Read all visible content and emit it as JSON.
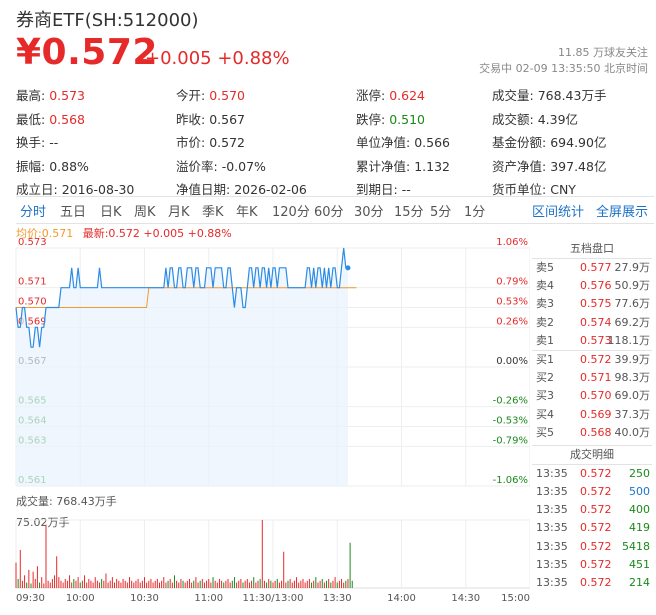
{
  "header": {
    "title": "券商ETF(SH:512000)",
    "price": "¥0.572",
    "change": "+0.005 +0.88%",
    "follow": "11.85 万球友关注",
    "status": "交易中 02-09 13:35:50 北京时间"
  },
  "stats": [
    [
      {
        "k": "最高:",
        "v": "0.573",
        "c": "red"
      },
      {
        "k": "今开:",
        "v": "0.570",
        "c": "red"
      },
      {
        "k": "涨停:",
        "v": "0.624",
        "c": "red"
      },
      {
        "k": "成交量:",
        "v": "768.43万手",
        "c": ""
      }
    ],
    [
      {
        "k": "最低:",
        "v": "0.568",
        "c": "red"
      },
      {
        "k": "昨收:",
        "v": "0.567",
        "c": ""
      },
      {
        "k": "跌停:",
        "v": "0.510",
        "c": "green"
      },
      {
        "k": "成交额:",
        "v": "4.39亿",
        "c": ""
      }
    ],
    [
      {
        "k": "换手:",
        "v": "--",
        "c": ""
      },
      {
        "k": "市价:",
        "v": "0.572",
        "c": ""
      },
      {
        "k": "单位净值:",
        "v": "0.566",
        "c": ""
      },
      {
        "k": "基金份额:",
        "v": "694.90亿",
        "c": ""
      }
    ],
    [
      {
        "k": "振幅:",
        "v": "0.88%",
        "c": ""
      },
      {
        "k": "溢价率:",
        "v": "-0.07%",
        "c": ""
      },
      {
        "k": "累计净值:",
        "v": "1.132",
        "c": ""
      },
      {
        "k": "资产净值:",
        "v": "397.48亿",
        "c": ""
      }
    ],
    [
      {
        "k": "成立日:",
        "v": "2016-08-30",
        "c": ""
      },
      {
        "k": "净值日期:",
        "v": "2026-02-06",
        "c": ""
      },
      {
        "k": "到期日:",
        "v": "--",
        "c": ""
      },
      {
        "k": "货币单位:",
        "v": "CNY",
        "c": ""
      }
    ]
  ],
  "tabs": [
    "分时",
    "五日",
    "日K",
    "周K",
    "月K",
    "季K",
    "年K",
    "120分",
    "60分",
    "30分",
    "15分",
    "5分",
    "1分"
  ],
  "tabs_right": [
    "区间统计",
    "全屏展示"
  ],
  "legend": {
    "avg": "均价:0.571",
    "last": "最新:0.572 +0.005 +0.88%"
  },
  "volume": {
    "label": "成交量: 768.43万手",
    "max": "75.02万手"
  },
  "order_book": {
    "title": "五档盘口",
    "asks": [
      {
        "label": "卖5",
        "price": "0.577",
        "qty": "27.9万"
      },
      {
        "label": "卖4",
        "price": "0.576",
        "qty": "50.9万"
      },
      {
        "label": "卖3",
        "price": "0.575",
        "qty": "77.6万"
      },
      {
        "label": "卖2",
        "price": "0.574",
        "qty": "69.2万"
      },
      {
        "label": "卖1",
        "price": "0.573",
        "qty": "118.1万"
      }
    ],
    "bids": [
      {
        "label": "买1",
        "price": "0.572",
        "qty": "39.9万"
      },
      {
        "label": "买2",
        "price": "0.571",
        "qty": "98.3万"
      },
      {
        "label": "买3",
        "price": "0.570",
        "qty": "69.0万"
      },
      {
        "label": "买4",
        "price": "0.569",
        "qty": "37.3万"
      },
      {
        "label": "买5",
        "price": "0.568",
        "qty": "40.0万"
      }
    ]
  },
  "trades": {
    "title": "成交明细",
    "rows": [
      {
        "time": "13:35",
        "price": "0.572",
        "qty": "250",
        "color": "#1a8a1a"
      },
      {
        "time": "13:35",
        "price": "0.572",
        "qty": "500",
        "color": "#1e73c8"
      },
      {
        "time": "13:35",
        "price": "0.572",
        "qty": "400",
        "color": "#1a8a1a"
      },
      {
        "time": "13:35",
        "price": "0.572",
        "qty": "419",
        "color": "#1a8a1a"
      },
      {
        "time": "13:35",
        "price": "0.572",
        "qty": "5418",
        "color": "#1a8a1a"
      },
      {
        "time": "13:35",
        "price": "0.572",
        "qty": "451",
        "color": "#1a8a1a"
      },
      {
        "time": "13:35",
        "price": "0.572",
        "qty": "214",
        "color": "#1a8a1a"
      }
    ]
  },
  "colors": {
    "up": "#e62a2a",
    "down": "#1a8a1a",
    "line": "#2b8be6",
    "avg": "#f29a2e",
    "accent": "#1e73c8"
  },
  "chart_data": {
    "type": "line",
    "title": "",
    "y_ticks": [
      "0.573",
      "0.571",
      "0.570",
      "0.569",
      "0.567",
      "0.565",
      "0.564",
      "0.563",
      "0.561"
    ],
    "y_tick_values": [
      0.573,
      0.571,
      0.57,
      0.569,
      0.567,
      0.565,
      0.564,
      0.563,
      0.561
    ],
    "pct_ticks": [
      "1.06%",
      "0.79%",
      "0.53%",
      "0.26%",
      "0.00%",
      "-0.26%",
      "-0.53%",
      "-0.79%",
      "-1.06%"
    ],
    "x_ticks": [
      "09:30",
      "10:00",
      "10:30",
      "11:00",
      "11:30/13:00",
      "13:30",
      "14:00",
      "14:30",
      "15:00"
    ],
    "ylim": [
      0.561,
      0.573
    ],
    "minutes_total": 240,
    "series": [
      {
        "values": [
          0.57,
          0.569,
          0.569,
          0.57,
          0.57,
          0.569,
          0.569,
          0.568,
          0.568,
          0.569,
          0.569,
          0.568,
          0.569,
          0.569,
          0.57,
          0.57,
          0.57,
          0.57,
          0.57,
          0.57,
          0.57,
          0.571,
          0.571,
          0.571,
          0.571,
          0.571,
          0.572,
          0.571,
          0.571,
          0.572,
          0.571,
          0.571,
          0.571,
          0.571,
          0.571,
          0.571,
          0.571,
          0.571,
          0.571,
          0.572,
          0.571,
          0.571,
          0.571,
          0.571,
          0.571,
          0.571,
          0.571,
          0.571,
          0.571,
          0.571,
          0.571,
          0.571,
          0.571,
          0.571,
          0.571,
          0.571,
          0.571,
          0.571,
          0.571,
          0.571,
          0.571,
          0.571,
          0.571,
          0.571,
          0.571,
          0.571,
          0.571,
          0.571,
          0.571,
          0.571,
          0.572,
          0.571,
          0.572,
          0.572,
          0.571,
          0.571,
          0.572,
          0.572,
          0.571,
          0.571,
          0.572,
          0.572,
          0.572,
          0.571,
          0.572,
          0.572,
          0.571,
          0.571,
          0.571,
          0.572,
          0.572,
          0.572,
          0.571,
          0.572,
          0.572,
          0.572,
          0.572,
          0.571,
          0.571,
          0.572,
          0.572,
          0.571,
          0.57,
          0.571,
          0.571,
          0.571,
          0.57,
          0.57,
          0.571,
          0.572,
          0.572,
          0.571,
          0.572,
          0.572,
          0.571,
          0.572,
          0.572,
          0.571,
          0.572,
          0.571,
          0.572,
          0.572,
          0.571,
          0.572,
          0.572,
          0.572,
          0.572,
          0.571,
          0.571,
          0.571,
          0.571,
          0.571,
          0.571,
          0.571,
          0.571,
          0.571,
          0.572,
          0.572,
          0.571,
          0.572,
          0.571,
          0.572,
          0.572,
          0.571,
          0.572,
          0.571,
          0.572,
          0.571,
          0.572,
          0.572,
          0.571,
          0.571,
          0.572,
          0.573,
          0.572,
          0.572
        ]
      },
      {
        "values": [
          0.57,
          0.57,
          0.57,
          0.57,
          0.57,
          0.57,
          0.57,
          0.57,
          0.57,
          0.57,
          0.57,
          0.57,
          0.57,
          0.57,
          0.57,
          0.57,
          0.57,
          0.57,
          0.57,
          0.57,
          0.57,
          0.57,
          0.57,
          0.57,
          0.57,
          0.57,
          0.57,
          0.57,
          0.57,
          0.57,
          0.57,
          0.57,
          0.57,
          0.57,
          0.57,
          0.57,
          0.57,
          0.57,
          0.57,
          0.57,
          0.57,
          0.57,
          0.57,
          0.57,
          0.57,
          0.57,
          0.57,
          0.57,
          0.57,
          0.57,
          0.57,
          0.57,
          0.57,
          0.57,
          0.57,
          0.57,
          0.57,
          0.57,
          0.57,
          0.57,
          0.57,
          0.57,
          0.571,
          0.571,
          0.571,
          0.571,
          0.571,
          0.571,
          0.571,
          0.571,
          0.571,
          0.571,
          0.571,
          0.571,
          0.571,
          0.571,
          0.571,
          0.571,
          0.571,
          0.571,
          0.571,
          0.571,
          0.571,
          0.571,
          0.571,
          0.571,
          0.571,
          0.571,
          0.571,
          0.571,
          0.571,
          0.571,
          0.571,
          0.571,
          0.571,
          0.571,
          0.571,
          0.571,
          0.571,
          0.571,
          0.571,
          0.571,
          0.571,
          0.571,
          0.571,
          0.571,
          0.571,
          0.571,
          0.571,
          0.571,
          0.571,
          0.571,
          0.571,
          0.571,
          0.571,
          0.571,
          0.571,
          0.571,
          0.571,
          0.571,
          0.571,
          0.571,
          0.571,
          0.571,
          0.571,
          0.571,
          0.571,
          0.571,
          0.571,
          0.571,
          0.571,
          0.571,
          0.571,
          0.571,
          0.571,
          0.571,
          0.571,
          0.571,
          0.571,
          0.571,
          0.571,
          0.571,
          0.571,
          0.571,
          0.571,
          0.571,
          0.571,
          0.571,
          0.571,
          0.571,
          0.571,
          0.571,
          0.571,
          0.571,
          0.571,
          0.571,
          0.571,
          0.571,
          0.571,
          0.571
        ]
      }
    ],
    "volume_values": [
      28,
      10,
      42,
      8,
      14,
      6,
      20,
      5,
      18,
      10,
      24,
      6,
      12,
      5,
      70,
      8,
      6,
      10,
      14,
      35,
      12,
      8,
      6,
      10,
      8,
      14,
      6,
      10,
      8,
      12,
      6,
      8,
      14,
      6,
      10,
      8,
      6,
      12,
      8,
      6,
      10,
      8,
      16,
      6,
      8,
      12,
      6,
      10,
      8,
      6,
      10,
      8,
      6,
      12,
      8,
      6,
      8,
      10,
      6,
      8,
      12,
      6,
      8,
      10,
      6,
      8,
      10,
      6,
      8,
      12,
      6,
      8,
      10,
      6,
      14,
      8,
      6,
      10,
      8,
      6,
      8,
      10,
      6,
      8,
      12,
      6,
      8,
      10,
      6,
      8,
      10,
      6,
      12,
      8,
      6,
      10,
      8,
      6,
      8,
      10,
      6,
      8,
      12,
      6,
      8,
      10,
      6,
      8,
      10,
      6,
      8,
      12,
      6,
      8,
      10,
      75,
      8,
      6,
      10,
      8,
      6,
      8,
      10,
      6,
      8,
      40,
      6,
      8,
      10,
      6,
      8,
      12,
      6,
      8,
      10,
      6,
      8,
      10,
      6,
      8,
      12,
      6,
      8,
      10,
      6,
      8,
      10,
      6,
      8,
      12,
      6,
      8,
      10,
      6,
      8,
      10,
      50,
      8
    ],
    "volume_ylim": [
      0,
      75.02
    ]
  }
}
